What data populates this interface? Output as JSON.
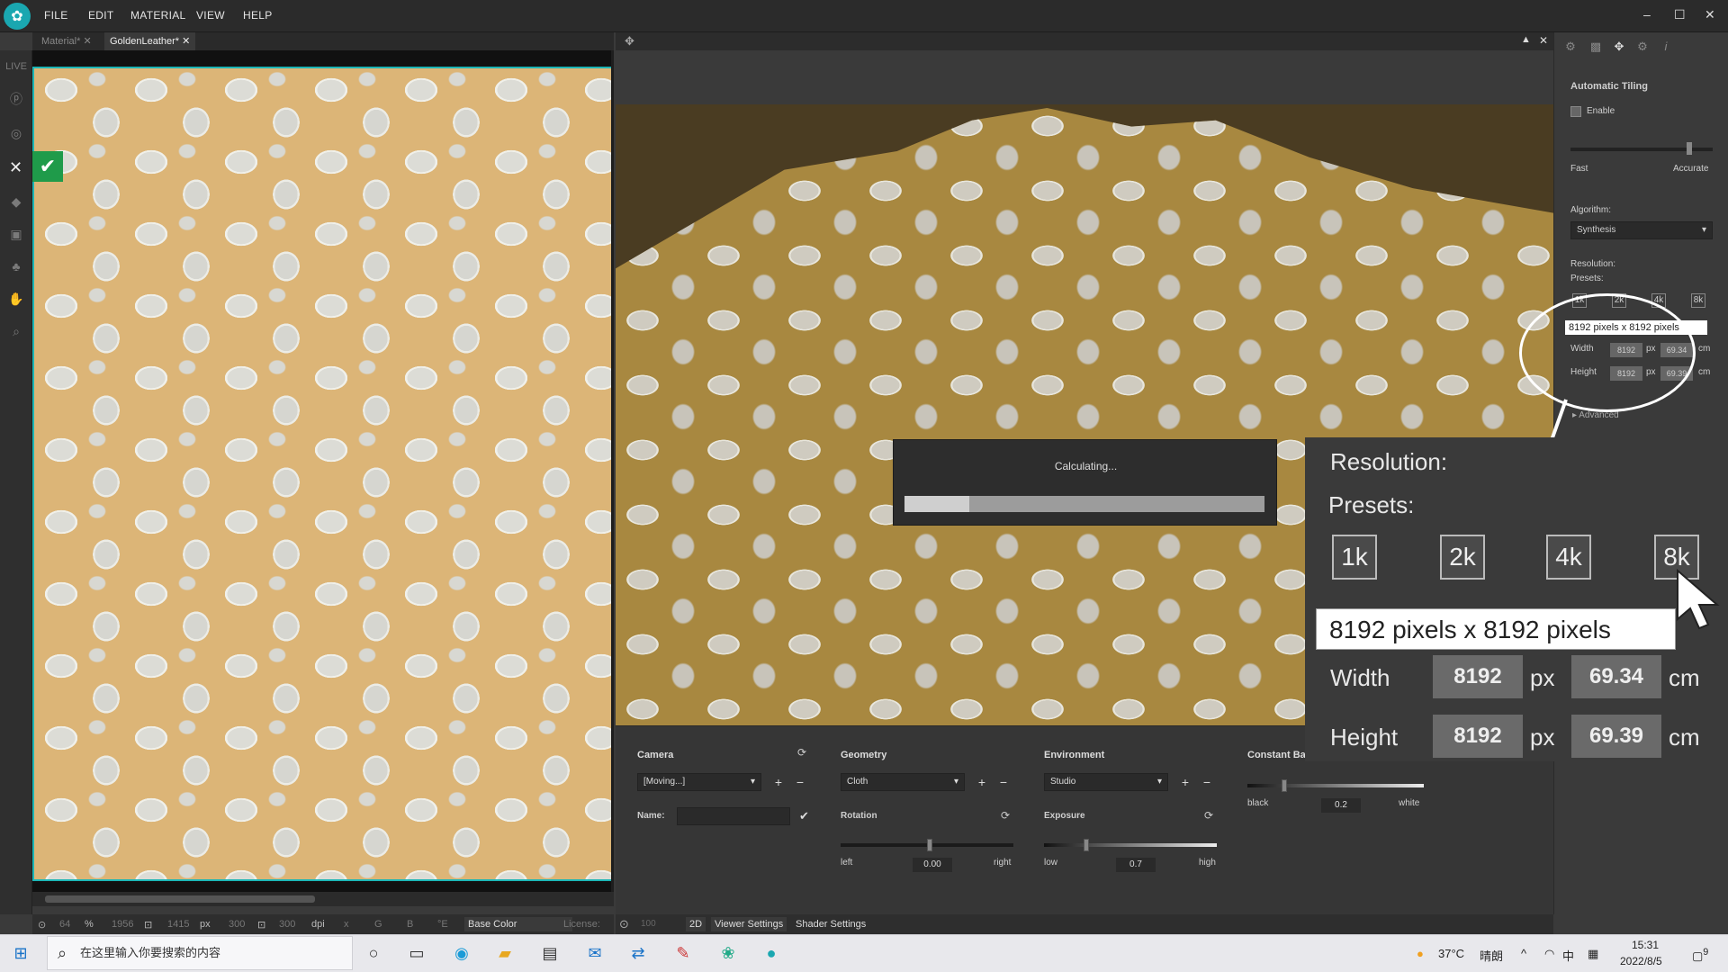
{
  "menu": [
    "FILE",
    "EDIT",
    "MATERIAL",
    "VIEW",
    "HELP"
  ],
  "tabs": [
    "Material*",
    "GoldenLeather*"
  ],
  "left_toolbar": {
    "live_label": "LIVE"
  },
  "left_status": {
    "zoom": "64",
    "pct": "%",
    "w": "1956",
    "h": "1415",
    "unit": "px",
    "dpi1": "300",
    "dpi2": "300",
    "dpi": "dpi",
    "x": "x",
    "g": "G",
    "b": "B",
    "e": "°E",
    "channel": "Base Color",
    "license": "License:"
  },
  "progress": {
    "label": "Calculating...",
    "value": 0.18
  },
  "camera": {
    "title": "Camera",
    "preset": "[Moving...]",
    "name_label": "Name:"
  },
  "geometry": {
    "title": "Geometry",
    "preset": "Cloth",
    "rotation_label": "Rotation",
    "left": "left",
    "right": "right",
    "rotation_value": "0.00"
  },
  "environment": {
    "title": "Environment",
    "preset": "Studio",
    "exposure_label": "Exposure",
    "low": "low",
    "high": "high",
    "exposure_value": "0.7"
  },
  "constant": {
    "title": "Constant Ba",
    "black": "black",
    "white": "white",
    "value": "0.2"
  },
  "vp_status": {
    "a": "100",
    "b": "2D",
    "viewer_tab": "Viewer Settings",
    "shader_tab": "Shader Settings"
  },
  "right_panel": {
    "section": "Automatic Tiling",
    "enable": "Enable",
    "fast": "Fast",
    "accurate": "Accurate",
    "quality": 0.85,
    "algorithm_label": "Algorithm:",
    "algorithm": "Synthesis",
    "resolution_label": "Resolution:",
    "presets_label": "Presets:",
    "presets": [
      "1k",
      "2k",
      "4k",
      "8k"
    ],
    "tooltip": "8192 pixels x 8192 pixels",
    "width_label": "Width",
    "height_label": "Height",
    "width_px": "8192",
    "height_px": "8192",
    "px": "px",
    "width_cm": "69.34",
    "height_cm": "69.39",
    "cm": "cm",
    "advanced": "Advanced"
  },
  "zoom": {
    "resolution": "Resolution:",
    "presets": "Presets:",
    "preset_labels": [
      "1k",
      "2k",
      "4k",
      "8k"
    ],
    "tooltip": "8192 pixels x 8192 pixels",
    "width": "Width",
    "height": "Height",
    "wpx": "8192",
    "hpx": "8192",
    "px": "px",
    "wcm": "69.34",
    "hcm": "69.39",
    "cm": "cm"
  },
  "taskbar": {
    "search_placeholder": "在这里输入你要搜索的内容",
    "temp": "37°C",
    "weather": "晴朗",
    "ime": "中",
    "time": "15:31",
    "date": "2022/8/5",
    "notif": "9"
  }
}
